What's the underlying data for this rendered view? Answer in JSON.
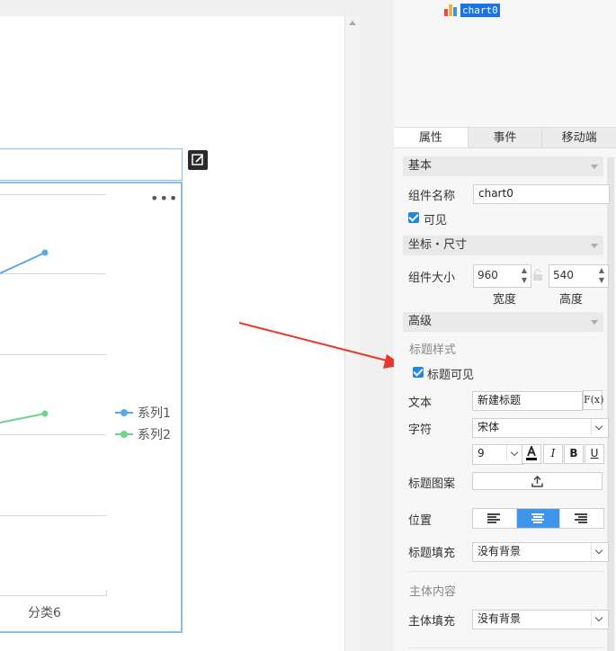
{
  "component_tree": {
    "item_label": "chart0"
  },
  "tabs": [
    {
      "label": "属性",
      "active": true
    },
    {
      "label": "事件",
      "active": false
    },
    {
      "label": "移动端",
      "active": false
    }
  ],
  "basic": {
    "header": "基本",
    "name_label": "组件名称",
    "name_value": "chart0",
    "visible_label": "可见"
  },
  "position": {
    "header": "坐标・尺寸",
    "size_label": "组件大小",
    "width_value": "960",
    "height_value": "540",
    "width_caption": "宽度",
    "height_caption": "高度"
  },
  "advanced": {
    "header": "高级",
    "title_style_label": "标题样式",
    "title_visible_label": "标题可见",
    "text_label": "文本",
    "text_value": "新建标题",
    "formula_button": "F(x)",
    "font_label": "字符",
    "font_value": "宋体",
    "font_size_value": "9",
    "bold_label": "B",
    "italic_label": "I",
    "underline_label": "U",
    "title_pattern_label": "标题图案",
    "position_label": "位置",
    "title_fill_label": "标题填充",
    "title_fill_value": "没有背景",
    "body_content_label": "主体内容",
    "body_fill_label": "主体填充",
    "body_fill_value": "没有背景"
  },
  "chart_data": {
    "type": "line",
    "categories": [
      "分类6"
    ],
    "series": [
      {
        "name": "系列1",
        "color": "#5aa9e6"
      },
      {
        "name": "系列2",
        "color": "#6cd48a"
      }
    ]
  },
  "colors": {
    "accent": "#1e88e5",
    "annotation_arrow": "#e8392c",
    "chart_border": "#8bbde9"
  }
}
